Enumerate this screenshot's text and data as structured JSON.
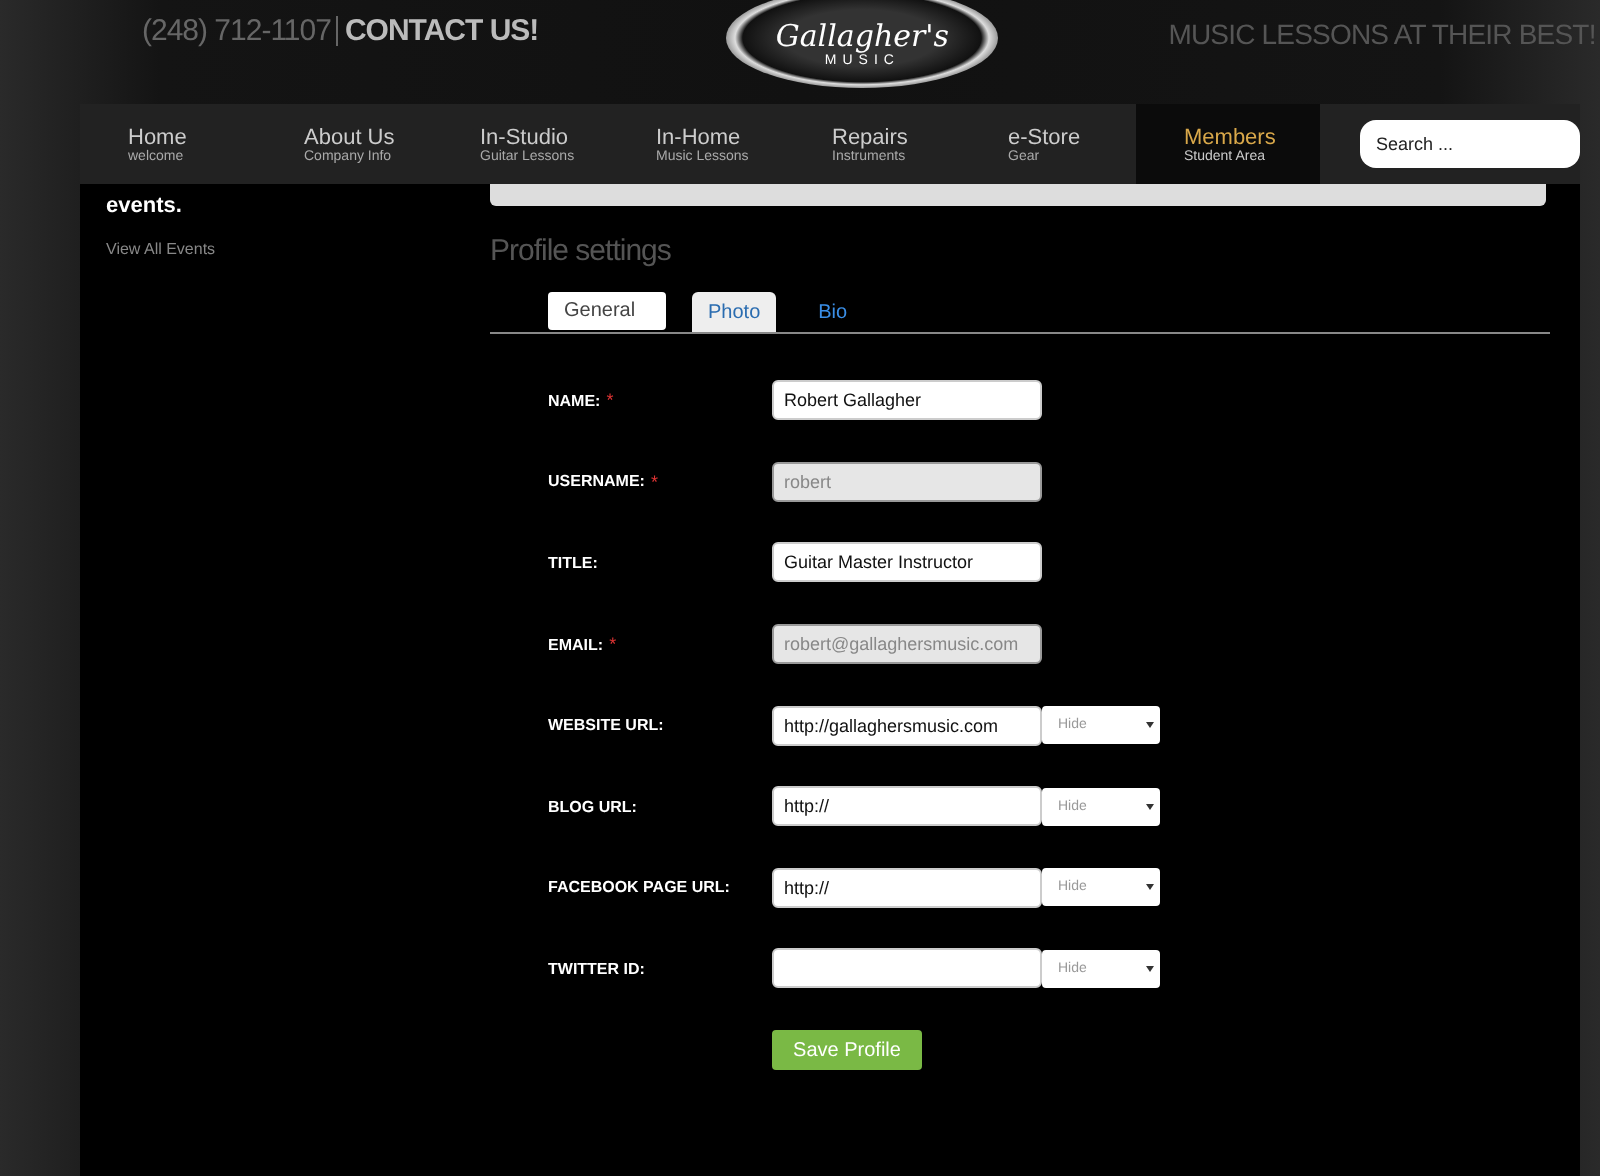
{
  "header": {
    "phone": "(248) 712-1107",
    "contact": "CONTACT US!",
    "logo_script": "Gallagher's",
    "logo_sub": "MUSIC",
    "tagline": "MUSIC LESSONS AT THEIR BEST!"
  },
  "nav": {
    "items": [
      {
        "label": "Home",
        "sub": "welcome",
        "selected": false
      },
      {
        "label": "About Us",
        "sub": "Company Info",
        "selected": false
      },
      {
        "label": "In-Studio",
        "sub": "Guitar Lessons",
        "selected": false
      },
      {
        "label": "In-Home",
        "sub": "Music Lessons",
        "selected": false
      },
      {
        "label": "Repairs",
        "sub": "Instruments",
        "selected": false
      },
      {
        "label": "e-Store",
        "sub": "Gear",
        "selected": false
      },
      {
        "label": "Members",
        "sub": "Student Area",
        "selected": true
      }
    ],
    "search": {
      "placeholder": "Search ..."
    }
  },
  "sidebar": {
    "text": "events.",
    "link": "View All Events"
  },
  "page": {
    "title": "Profile settings",
    "tabs": [
      {
        "label": "General",
        "selected": true
      },
      {
        "label": "Photo",
        "selected": false
      },
      {
        "label": "Bio",
        "selected": false
      }
    ],
    "fields": [
      {
        "label": "NAME:",
        "required_mark": "*",
        "value": "Robert Gallagher",
        "disabled": false
      },
      {
        "label": "USERNAME:",
        "required_mark": "*",
        "value": "robert",
        "disabled": true
      },
      {
        "label": "TITLE:",
        "value": "Guitar Master Instructor",
        "disabled": false
      },
      {
        "label": "EMAIL:",
        "required_mark": "*",
        "value": "robert@gallaghersmusic.com",
        "disabled": true
      },
      {
        "label": "WEBSITE URL:",
        "value": "http://gallaghersmusic.com",
        "disabled": false,
        "visibility": "Hide"
      },
      {
        "label": "BLOG URL:",
        "value": "http://",
        "disabled": false,
        "visibility": "Hide"
      },
      {
        "label": "FACEBOOK PAGE URL:",
        "value": "http://",
        "disabled": false,
        "visibility": "Hide"
      },
      {
        "label": "TWITTER ID:",
        "disabled": false,
        "visibility": "Hide"
      }
    ],
    "submit": "Save Profile"
  }
}
